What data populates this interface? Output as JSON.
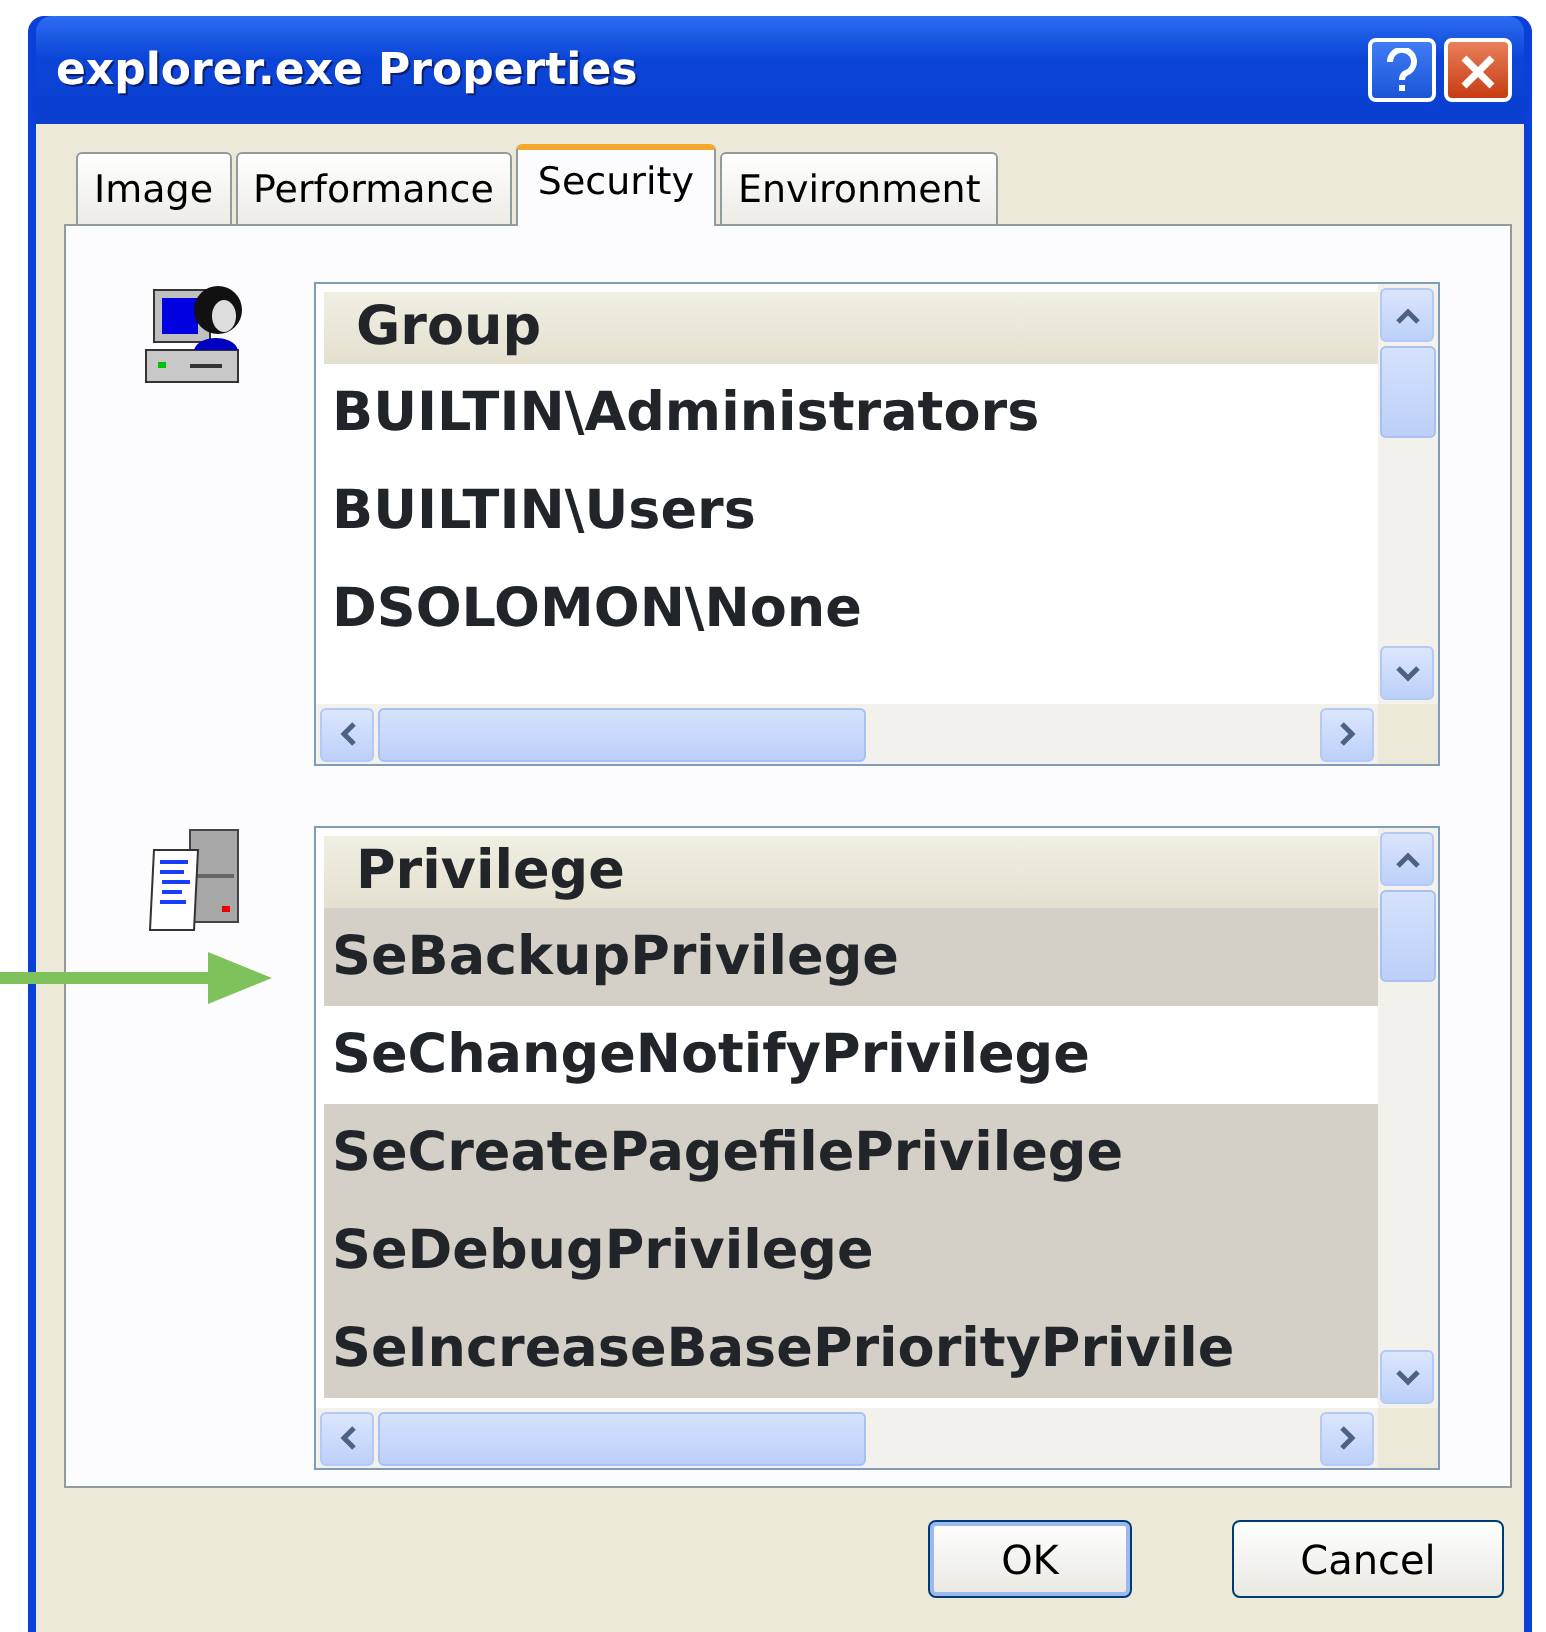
{
  "window": {
    "title": "explorer.exe Properties"
  },
  "tabs": [
    {
      "label": "Image",
      "selected": false
    },
    {
      "label": "Performance",
      "selected": false
    },
    {
      "label": "Security",
      "selected": true
    },
    {
      "label": "Environment",
      "selected": false
    }
  ],
  "groups": {
    "header": "Group",
    "rows": [
      "BUILTIN\\Administrators",
      "BUILTIN\\Users",
      "DSOLOMON\\None"
    ]
  },
  "privileges": {
    "header": "Privilege",
    "rows": [
      {
        "name": "SeBackupPrivilege",
        "enabled": false
      },
      {
        "name": "SeChangeNotifyPrivilege",
        "enabled": true
      },
      {
        "name": "SeCreatePagefilePrivilege",
        "enabled": false
      },
      {
        "name": "SeDebugPrivilege",
        "enabled": false
      },
      {
        "name": "SeIncreaseBasePriorityPrivile",
        "enabled": false
      }
    ]
  },
  "buttons": [
    "OK",
    "Cancel"
  ]
}
